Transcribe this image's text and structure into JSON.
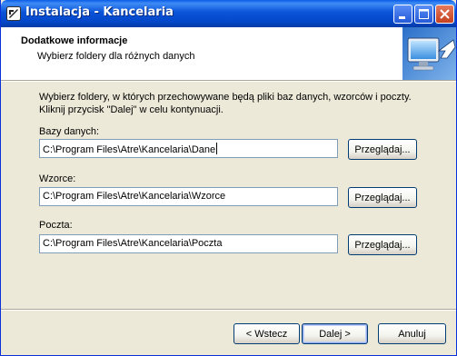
{
  "window": {
    "title": "Instalacja - Kancelaria"
  },
  "header": {
    "title": "Dodatkowe informacje",
    "subtitle": "Wybierz foldery dla różnych danych"
  },
  "instructions": "Wybierz foldery, w których przechowywane będą pliki baz danych, wzorców i poczty. Kliknij przycisk \"Dalej\" w celu kontynuacji.",
  "fields": [
    {
      "label": "Bazy danych:",
      "value": "C:\\Program Files\\Atre\\Kancelaria\\Dane",
      "browse_label": "Przeglądaj..."
    },
    {
      "label": "Wzorce:",
      "value": "C:\\Program Files\\Atre\\Kancelaria\\Wzorce",
      "browse_label": "Przeglądaj..."
    },
    {
      "label": "Poczta:",
      "value": "C:\\Program Files\\Atre\\Kancelaria\\Poczta",
      "browse_label": "Przeglądaj..."
    }
  ],
  "buttons": {
    "back": "< Wstecz",
    "next": "Dalej >",
    "cancel": "Anuluj"
  },
  "icons": {
    "app": "installer-icon",
    "minimize": "minimize-icon",
    "maximize": "maximize-icon",
    "close": "close-icon",
    "header": "monitor-arrow-icon"
  },
  "colors": {
    "titlebar": "#0A53D8",
    "dialog_bg": "#ECE9D8",
    "close_button": "#C5401E",
    "field_border": "#7F9DB9"
  }
}
